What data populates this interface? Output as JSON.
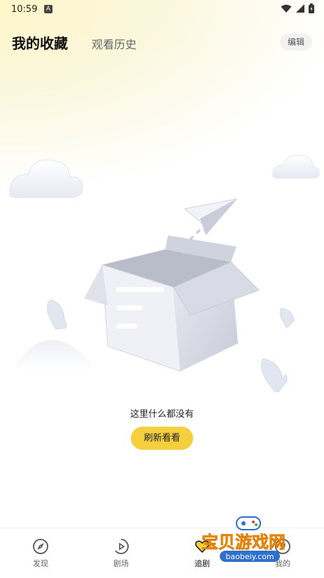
{
  "status_bar": {
    "time": "10:59",
    "app_badge": "A"
  },
  "tabs": {
    "favorites": "我的收藏",
    "history": "观看历史"
  },
  "toolbar": {
    "edit_label": "编辑"
  },
  "empty_state": {
    "message": "这里什么都没有",
    "refresh_label": "刷新看看"
  },
  "bottom_nav": {
    "items": [
      {
        "label": "发现",
        "icon": "compass-icon"
      },
      {
        "label": "剧场",
        "icon": "play-icon"
      },
      {
        "label": "追剧",
        "icon": "heart-icon",
        "active": true
      },
      {
        "label": "我的",
        "icon": "user-icon"
      }
    ]
  },
  "watermark": {
    "title": "宝贝游戏网",
    "url": "baobeiy.com"
  },
  "colors": {
    "accent": "#f6cf3e",
    "highlight": "#f6d24a"
  }
}
